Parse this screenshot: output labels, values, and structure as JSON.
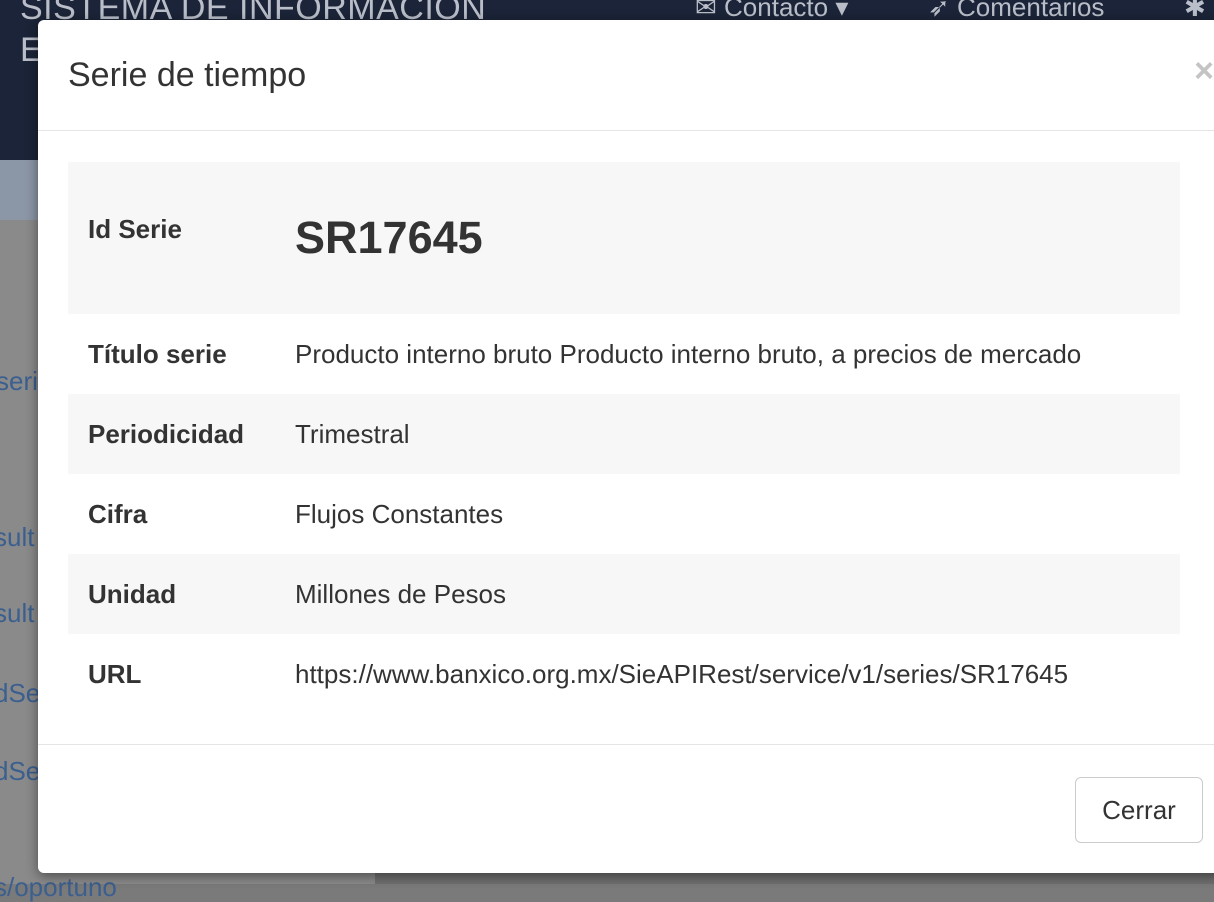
{
  "background": {
    "header_line1": "SISTEMA DE INFORMACIÓN",
    "header_line2": "E",
    "nav": [
      {
        "icon": "envelope-icon",
        "label": "Contacto ▾"
      },
      {
        "icon": "paper-plane-icon",
        "label": "Comentarios"
      }
    ],
    "side_links": [
      "seri",
      "sult",
      "sult",
      "dSe",
      "dSe",
      "s/oportuno"
    ]
  },
  "modal": {
    "title": "Serie de tiempo",
    "close_symbol": "×",
    "rows": [
      {
        "label": "Id Serie",
        "value": "SR17645"
      },
      {
        "label": "Título serie",
        "value": "Producto interno bruto Producto interno bruto, a precios de mercado"
      },
      {
        "label": "Periodicidad",
        "value": "Trimestral"
      },
      {
        "label": "Cifra",
        "value": "Flujos Constantes"
      },
      {
        "label": "Unidad",
        "value": "Millones de Pesos"
      },
      {
        "label": "URL",
        "value": "https://www.banxico.org.mx/SieAPIRest/service/v1/series/SR17645"
      }
    ],
    "footer_button": "Cerrar"
  }
}
